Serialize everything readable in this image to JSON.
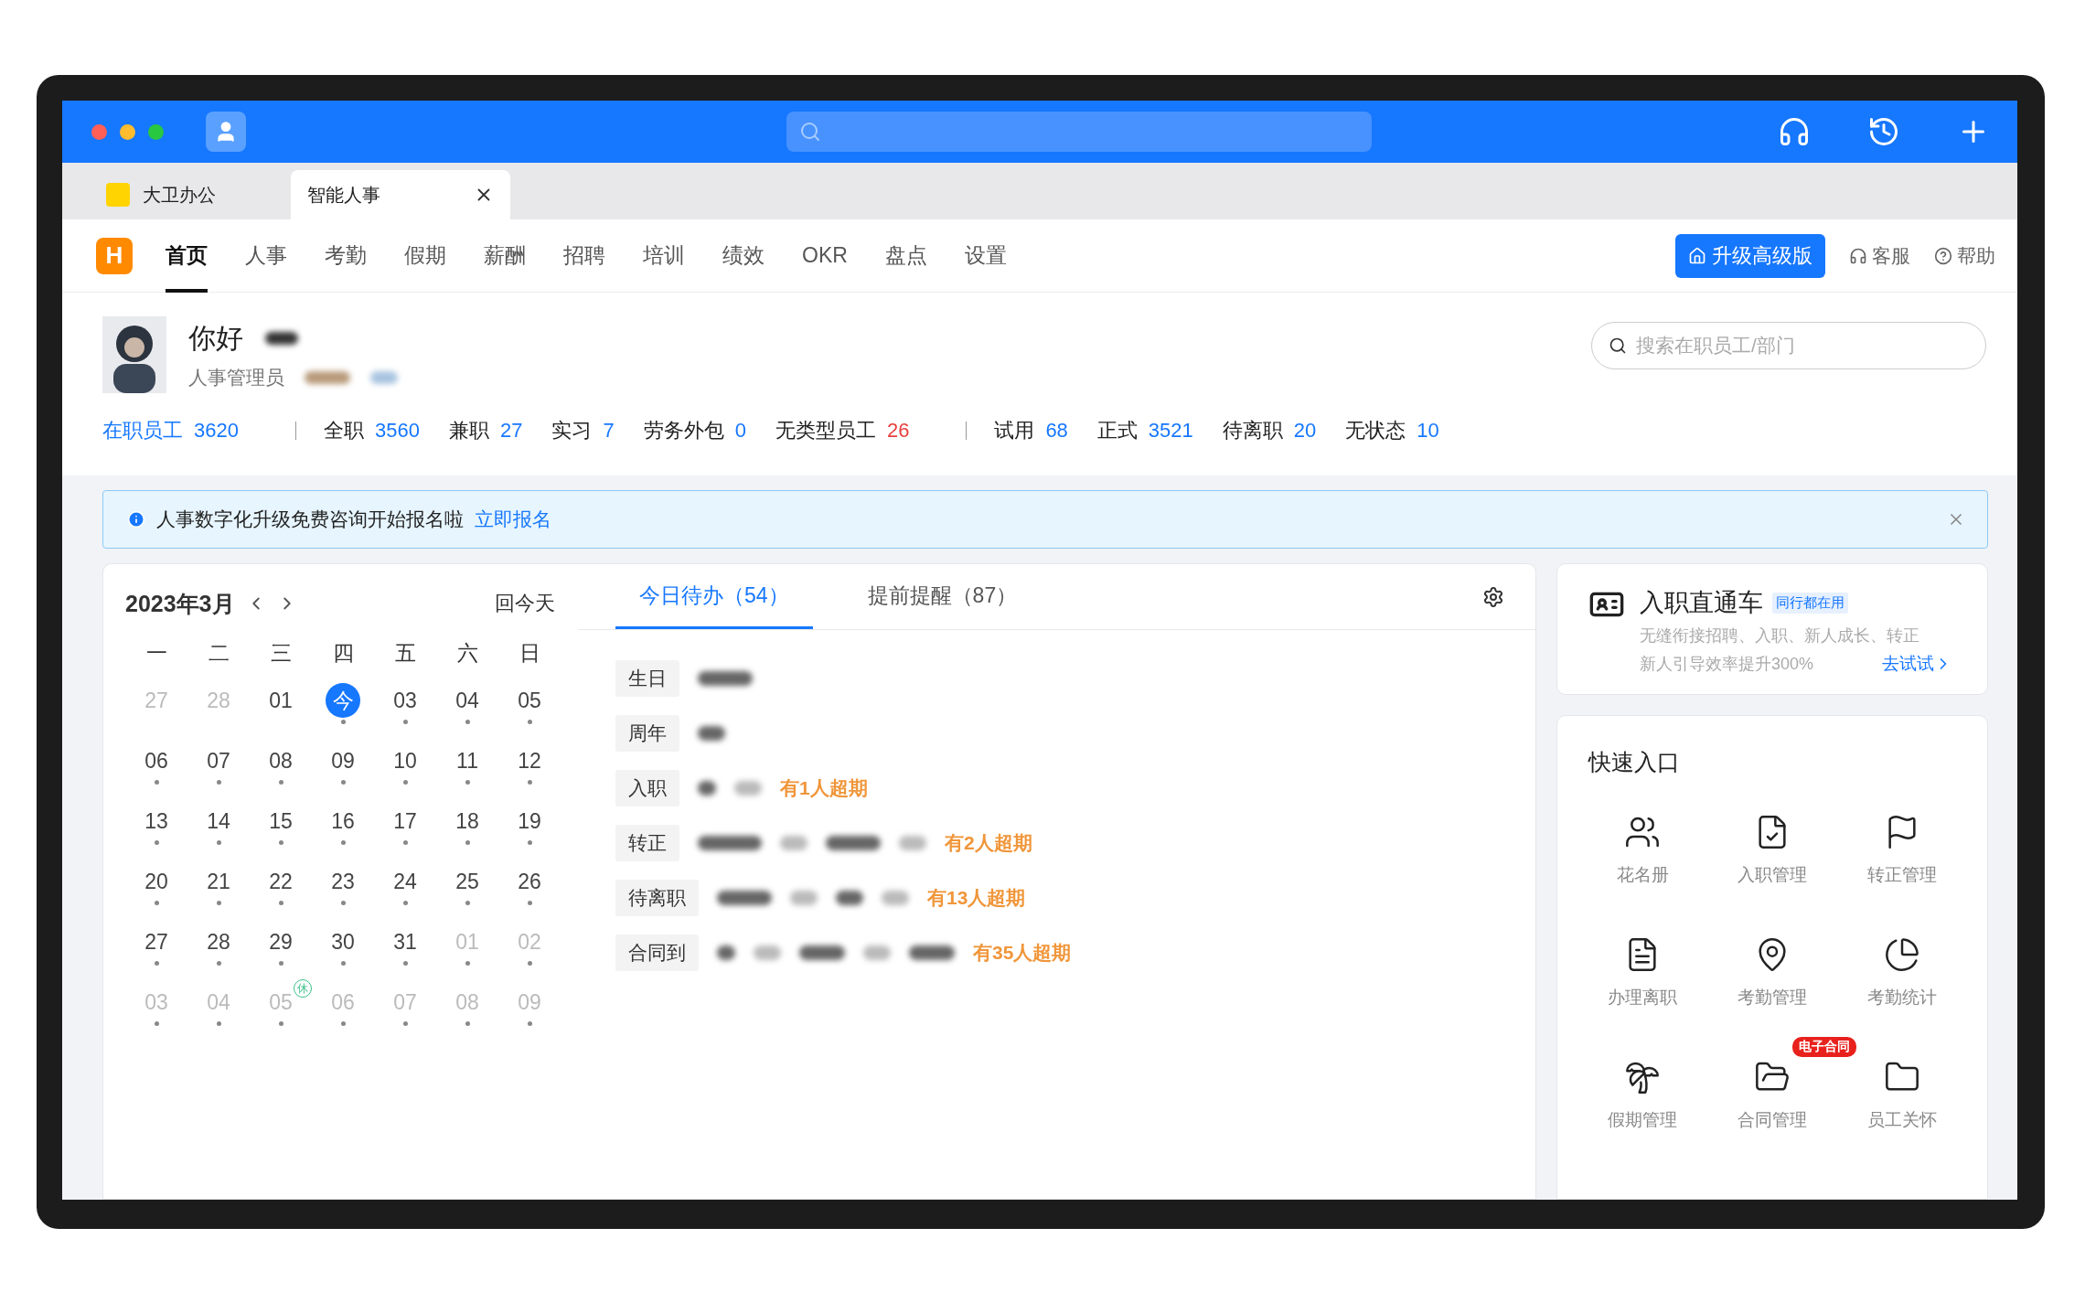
{
  "browser_tabs": [
    {
      "label": "大卫办公",
      "selected": false
    },
    {
      "label": "智能人事",
      "selected": true
    }
  ],
  "nav": {
    "logo": "H",
    "items": [
      {
        "label": "首页",
        "selected": true
      },
      {
        "label": "人事",
        "selected": false
      },
      {
        "label": "考勤",
        "selected": false
      },
      {
        "label": "假期",
        "selected": false
      },
      {
        "label": "薪酬",
        "selected": false
      },
      {
        "label": "招聘",
        "selected": false
      },
      {
        "label": "培训",
        "selected": false
      },
      {
        "label": "绩效",
        "selected": false
      },
      {
        "label": "OKR",
        "selected": false
      },
      {
        "label": "盘点",
        "selected": false
      },
      {
        "label": "设置",
        "selected": false
      }
    ],
    "upgrade": "升级高级版",
    "links": [
      "客服",
      "帮助"
    ]
  },
  "profile": {
    "greeting": "你好",
    "role": "人事管理员",
    "search_placeholder": "搜索在职员工/部门"
  },
  "stats": [
    [
      {
        "label": "在职员工",
        "value": "3620",
        "kind": "total",
        "color": "#1677ff"
      }
    ],
    [
      {
        "label": "全职",
        "value": "3560",
        "kind": "item",
        "color": "#1677ff"
      },
      {
        "label": "兼职",
        "value": "27",
        "kind": "item",
        "color": "#1677ff"
      },
      {
        "label": "实习",
        "value": "7",
        "kind": "item",
        "color": "#1677ff"
      },
      {
        "label": "劳务外包",
        "value": "0",
        "kind": "item",
        "color": "#1677ff"
      },
      {
        "label": "无类型员工",
        "value": "26",
        "kind": "item",
        "color": "#e8413d"
      }
    ],
    [
      {
        "label": "试用",
        "value": "68",
        "kind": "item",
        "color": "#1677ff"
      },
      {
        "label": "正式",
        "value": "3521",
        "kind": "item",
        "color": "#1677ff"
      },
      {
        "label": "待离职",
        "value": "20",
        "kind": "item",
        "color": "#1677ff"
      },
      {
        "label": "无状态",
        "value": "10",
        "kind": "item",
        "color": "#1677ff"
      }
    ]
  ],
  "notice": {
    "text": "人事数字化升级免费咨询开始报名啦",
    "link": "立即报名"
  },
  "calendar": {
    "title": "2023年3月",
    "today_button": "回今天",
    "weekdays": [
      "一",
      "二",
      "三",
      "四",
      "五",
      "六",
      "日"
    ],
    "weeks": [
      [
        {
          "label": "27",
          "muted": true,
          "dot": false,
          "today": false
        },
        {
          "label": "28",
          "muted": true,
          "dot": false,
          "today": false
        },
        {
          "label": "01",
          "muted": false,
          "dot": false,
          "today": false
        },
        {
          "label": "今",
          "muted": false,
          "dot": true,
          "today": true
        },
        {
          "label": "03",
          "muted": false,
          "dot": true,
          "today": false
        },
        {
          "label": "04",
          "muted": false,
          "dot": true,
          "today": false
        },
        {
          "label": "05",
          "muted": false,
          "dot": true,
          "today": false
        }
      ],
      [
        {
          "label": "06",
          "muted": false,
          "dot": true,
          "today": false
        },
        {
          "label": "07",
          "muted": false,
          "dot": true,
          "today": false
        },
        {
          "label": "08",
          "muted": false,
          "dot": true,
          "today": false
        },
        {
          "label": "09",
          "muted": false,
          "dot": true,
          "today": false
        },
        {
          "label": "10",
          "muted": false,
          "dot": true,
          "today": false
        },
        {
          "label": "11",
          "muted": false,
          "dot": true,
          "today": false
        },
        {
          "label": "12",
          "muted": false,
          "dot": true,
          "today": false
        }
      ],
      [
        {
          "label": "13",
          "muted": false,
          "dot": true,
          "today": false
        },
        {
          "label": "14",
          "muted": false,
          "dot": true,
          "today": false
        },
        {
          "label": "15",
          "muted": false,
          "dot": true,
          "today": false
        },
        {
          "label": "16",
          "muted": false,
          "dot": true,
          "today": false
        },
        {
          "label": "17",
          "muted": false,
          "dot": true,
          "today": false
        },
        {
          "label": "18",
          "muted": false,
          "dot": true,
          "today": false
        },
        {
          "label": "19",
          "muted": false,
          "dot": true,
          "today": false
        }
      ],
      [
        {
          "label": "20",
          "muted": false,
          "dot": true,
          "today": false
        },
        {
          "label": "21",
          "muted": false,
          "dot": true,
          "today": false
        },
        {
          "label": "22",
          "muted": false,
          "dot": true,
          "today": false
        },
        {
          "label": "23",
          "muted": false,
          "dot": true,
          "today": false
        },
        {
          "label": "24",
          "muted": false,
          "dot": true,
          "today": false
        },
        {
          "label": "25",
          "muted": false,
          "dot": true,
          "today": false
        },
        {
          "label": "26",
          "muted": false,
          "dot": true,
          "today": false
        }
      ],
      [
        {
          "label": "27",
          "muted": false,
          "dot": true,
          "today": false
        },
        {
          "label": "28",
          "muted": false,
          "dot": true,
          "today": false
        },
        {
          "label": "29",
          "muted": false,
          "dot": true,
          "today": false
        },
        {
          "label": "30",
          "muted": false,
          "dot": true,
          "today": false
        },
        {
          "label": "31",
          "muted": false,
          "dot": true,
          "today": false
        },
        {
          "label": "01",
          "muted": true,
          "dot": true,
          "today": false
        },
        {
          "label": "02",
          "muted": true,
          "dot": true,
          "today": false
        }
      ],
      [
        {
          "label": "03",
          "muted": true,
          "dot": true,
          "today": false
        },
        {
          "label": "04",
          "muted": true,
          "dot": true,
          "today": false
        },
        {
          "label": "05",
          "muted": true,
          "dot": true,
          "today": false,
          "badge": "休"
        },
        {
          "label": "06",
          "muted": true,
          "dot": true,
          "today": false
        },
        {
          "label": "07",
          "muted": true,
          "dot": true,
          "today": false
        },
        {
          "label": "08",
          "muted": true,
          "dot": true,
          "today": false
        },
        {
          "label": "09",
          "muted": true,
          "dot": true,
          "today": false
        }
      ]
    ]
  },
  "todo": {
    "tabs": [
      {
        "label": "今日待办（54）",
        "selected": true
      },
      {
        "label": "提前提醒（87）",
        "selected": false
      }
    ],
    "rows": [
      {
        "label": "生日"
      },
      {
        "label": "周年"
      },
      {
        "label": "入职",
        "overdue": "有1人超期"
      },
      {
        "label": "转正",
        "overdue": "有2人超期"
      },
      {
        "label": "待离职",
        "overdue": "有13人超期"
      },
      {
        "label": "合同到",
        "overdue": "有35人超期"
      }
    ]
  },
  "promo": {
    "title": "入职直通车",
    "tag": "同行都在用",
    "lines": [
      "无缝衔接招聘、入职、新人成长、转正",
      "新人引导效率提升300%"
    ],
    "link": "去试试"
  },
  "quick": {
    "title": "快速入口",
    "items": [
      {
        "label": "花名册"
      },
      {
        "label": "入职管理"
      },
      {
        "label": "转正管理"
      },
      {
        "label": "办理离职"
      },
      {
        "label": "考勤管理"
      },
      {
        "label": "考勤统计"
      },
      {
        "label": "假期管理"
      },
      {
        "label": "合同管理",
        "badge": "电子合同"
      },
      {
        "label": "员工关怀"
      }
    ]
  }
}
